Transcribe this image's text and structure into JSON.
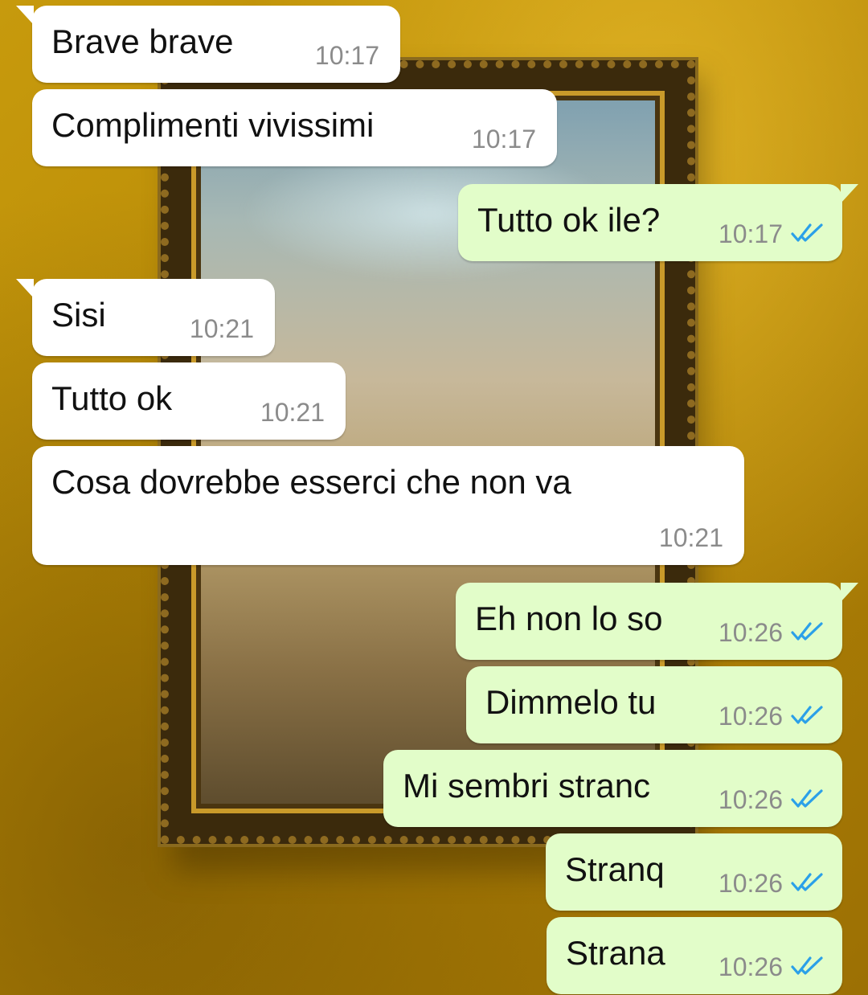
{
  "colors": {
    "incoming_bubble": "#ffffff",
    "outgoing_bubble": "#e2fdc9",
    "read_ticks": "#2ba0e8",
    "timestamp": "#8b8b8b",
    "message_text": "#111111"
  },
  "messages": [
    {
      "direction": "incoming",
      "text": "Brave brave",
      "time": "10:17"
    },
    {
      "direction": "incoming",
      "text": "Complimenti vivissimi",
      "time": "10:17"
    },
    {
      "direction": "outgoing",
      "text": "Tutto ok ile?",
      "time": "10:17",
      "status_icon": "double-check-read-icon"
    },
    {
      "direction": "incoming",
      "text": "Sisi",
      "time": "10:21"
    },
    {
      "direction": "incoming",
      "text": "Tutto ok",
      "time": "10:21"
    },
    {
      "direction": "incoming",
      "text": "Cosa dovrebbe esserci che non va",
      "time": "10:21"
    },
    {
      "direction": "outgoing",
      "text": "Eh non lo so",
      "time": "10:26",
      "status_icon": "double-check-read-icon"
    },
    {
      "direction": "outgoing",
      "text": "Dimmelo tu",
      "time": "10:26",
      "status_icon": "double-check-read-icon"
    },
    {
      "direction": "outgoing",
      "text": "Mi sembri stranc",
      "time": "10:26",
      "status_icon": "double-check-read-icon"
    },
    {
      "direction": "outgoing",
      "text": "Stranq",
      "time": "10:26",
      "status_icon": "double-check-read-icon"
    },
    {
      "direction": "outgoing",
      "text": "Strana",
      "time": "10:26",
      "status_icon": "double-check-read-icon"
    }
  ]
}
